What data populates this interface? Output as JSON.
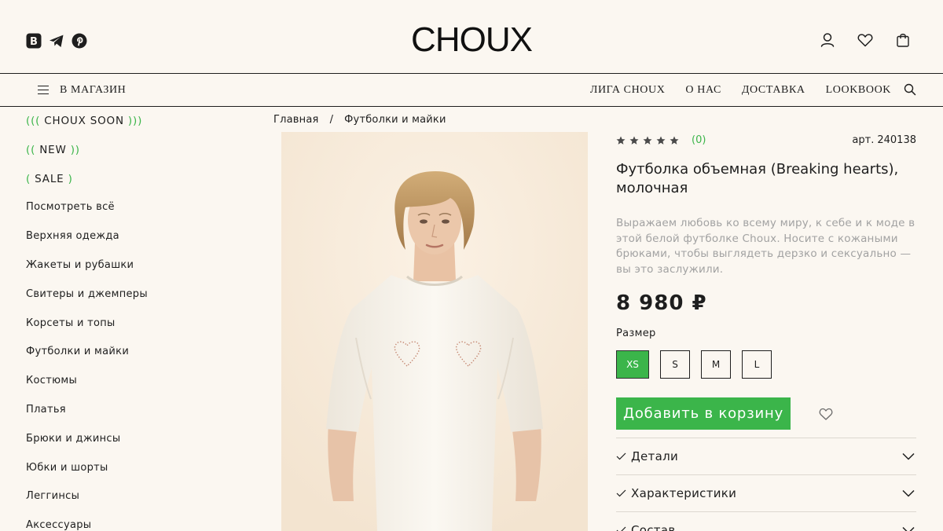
{
  "colors": {
    "accent": "#3bb54a",
    "background": "#fbf7f1",
    "text": "#1e1e1e",
    "muted": "#a2a2a2"
  },
  "header": {
    "logo": "CHOUX",
    "social_icons": [
      "vk-icon",
      "telegram-icon",
      "pinterest-icon"
    ],
    "right_icons": [
      "user-icon",
      "heart-icon",
      "bag-icon"
    ]
  },
  "nav": {
    "menu_label": "В МАГАЗИН",
    "links": [
      "ЛИГА CHOUX",
      "О НАС",
      "ДОСТАВКА",
      "LOOKBOOK"
    ],
    "search_icon": "search-icon"
  },
  "sidebar": {
    "promo": [
      {
        "pre": "((( ",
        "label": "CHOUX SOON",
        "post": " )))"
      },
      {
        "pre": "(( ",
        "label": "NEW",
        "post": " ))"
      },
      {
        "pre": "( ",
        "label": "SALE",
        "post": " )"
      }
    ],
    "items": [
      "Посмотреть всё",
      "Верхняя одежда",
      "Жакеты и рубашки",
      "Свитеры и джемперы",
      "Корсеты и топы",
      "Футболки и майки",
      "Костюмы",
      "Платья",
      "Брюки и джинсы",
      "Юбки и шорты",
      "Леггинсы",
      "Аксессуары"
    ]
  },
  "breadcrumb": {
    "home": "Главная",
    "separator": "/",
    "current": "Футболки и майки"
  },
  "product": {
    "rating": 0,
    "max_rating": 5,
    "reviews": "(0)",
    "article_label": "арт.",
    "article": "240138",
    "title": "Футболка объемная (Breaking hearts), молочная",
    "description": "Выражаем любовь ко всему миру, к себе и к моде в этой белой футболке Choux. Носите с кожаными брюками, чтобы выглядеть дерзко и сексуально — вы это заслужили.",
    "price": "8 980 ₽",
    "size_label": "Размер",
    "sizes": [
      "XS",
      "S",
      "M",
      "L"
    ],
    "selected_size": "XS",
    "add_to_cart": "Добавить в корзину",
    "accordion": [
      "Детали",
      "Характеристики",
      "Состав"
    ]
  }
}
